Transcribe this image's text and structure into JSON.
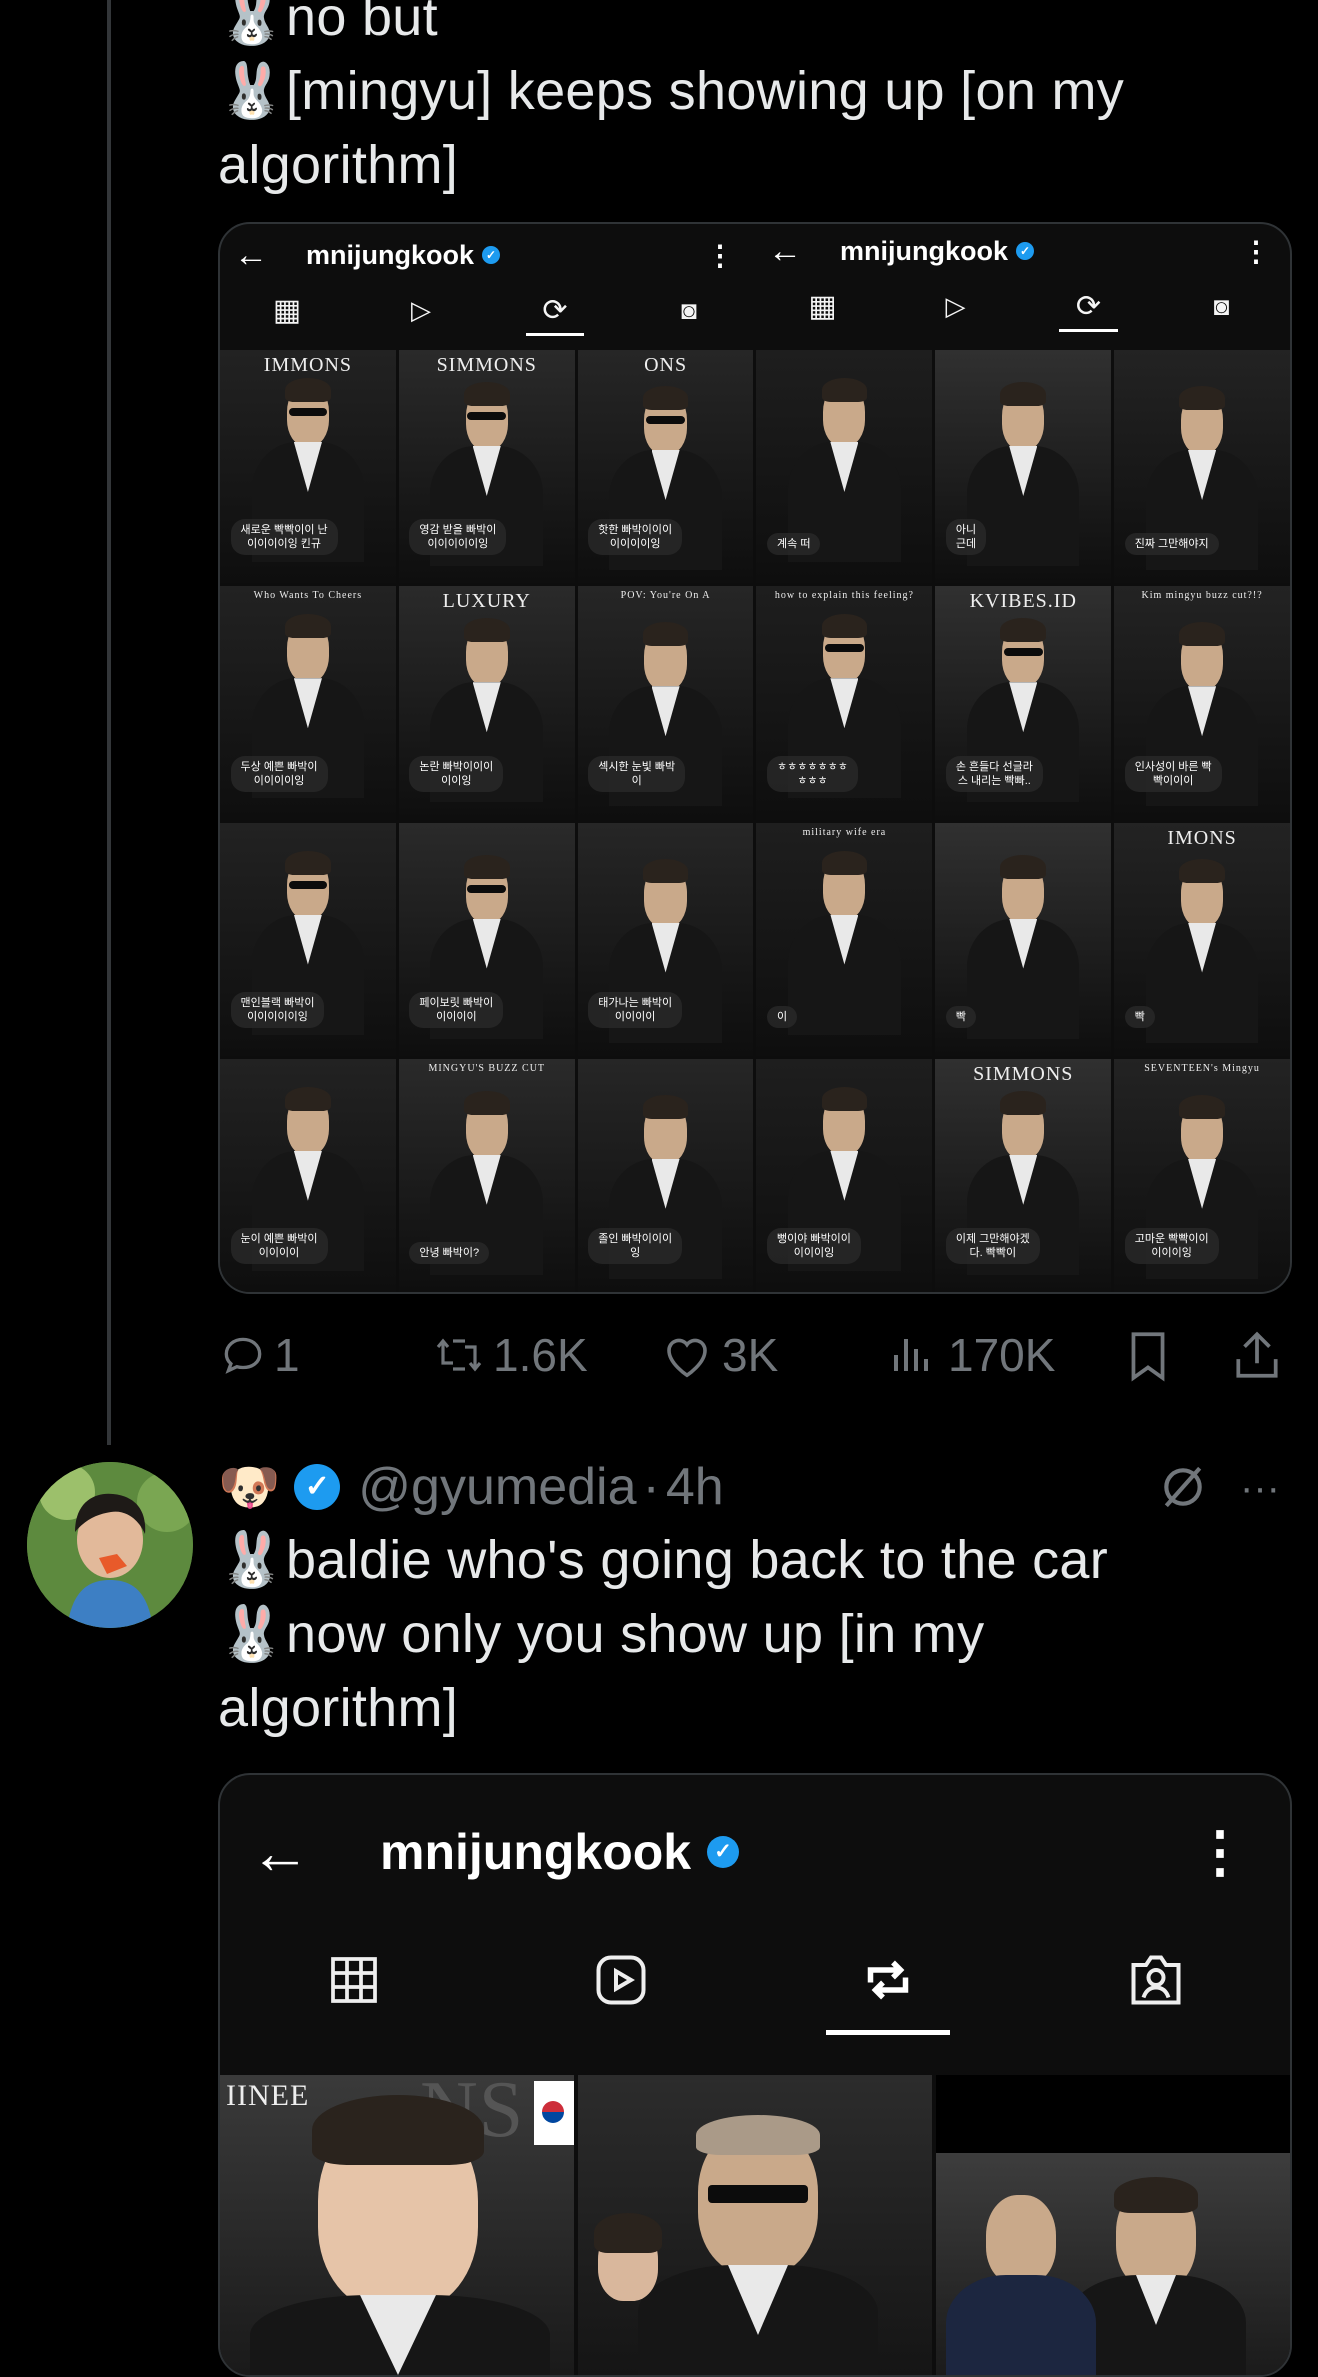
{
  "tweet1": {
    "line1": "no but",
    "line2": "[mingyu] keeps showing up [on my",
    "line3": "algorithm]",
    "emoji1": "🐰",
    "emoji2": "🐰"
  },
  "shot1": {
    "left": {
      "username": "mnijungkook"
    },
    "right": {
      "username": "mnijungkook"
    },
    "cells": [
      {
        "caption": "새로운 빡빡이이 난\n이이이이잉 킨규",
        "top": "IMMONS"
      },
      {
        "caption": "영감 받을 빠박이\n이이이이이잉",
        "top": "SIMMONS"
      },
      {
        "caption": "핫한 빠박이이이\n이이이이잉",
        "top": "ONS"
      },
      {
        "caption": "계속 떠",
        "top": ""
      },
      {
        "caption": "아니\n근데",
        "top": ""
      },
      {
        "caption": "진짜 그만해야지",
        "top": ""
      },
      {
        "caption": "두상 예쁜 빠박이\n이이이이잉",
        "top": "Who Wants To Cheers"
      },
      {
        "caption": "논란 빠박이이이\n이이잉",
        "top": "LUXURY"
      },
      {
        "caption": "섹시한 눈빛 빠박\n이",
        "top": "POV: You're On A"
      },
      {
        "caption": "ㅎㅎㅎㅎㅎㅎㅎ\nㅎㅎㅎ",
        "top": "how to explain this feeling?"
      },
      {
        "caption": "손 흔들다 선글라\n스 내리는 빡빠..",
        "top": "KVIBES.ID"
      },
      {
        "caption": "인사성이 바른 빡\n빡이이이",
        "top": "Kim mingyu buzz cut?!?"
      },
      {
        "caption": "맨인블랙 빠박이\n이이이이이잉",
        "top": ""
      },
      {
        "caption": "페이보릿 빠박이\n이이이이",
        "top": ""
      },
      {
        "caption": "태가나는 빠박이\n이이이이",
        "top": ""
      },
      {
        "caption": "이",
        "top": "military wife era"
      },
      {
        "caption": "빡",
        "top": ""
      },
      {
        "caption": "빡",
        "top": "IMONS"
      },
      {
        "caption": "눈이 예쁜 빠박이\n이이이이",
        "top": ""
      },
      {
        "caption": "안녕 빠박이?",
        "top": "MINGYU'S BUZZ CUT"
      },
      {
        "caption": "졸인 빠박이이이\n잉",
        "top": ""
      },
      {
        "caption": "뻥이야 빠박이이\n이이이잉",
        "top": ""
      },
      {
        "caption": "이제 그만해야겠\n다. 빡빡이",
        "top": "SIMMONS"
      },
      {
        "caption": "고마운 빡빡이이\n이이이잉",
        "top": "SEVENTEEN's Mingyu"
      }
    ]
  },
  "actions": {
    "replies": "1",
    "reposts": "1.6K",
    "likes": "3K",
    "views": "170K"
  },
  "tweet2": {
    "emoji_badge": "🐶",
    "handle": "@gyumedia",
    "dot": "·",
    "time": "4h",
    "more": "···",
    "line1": "baldie who's going back to the car",
    "line2": "now only you show up [in my",
    "line3": "algorithm]",
    "emoji1": "🐰",
    "emoji2": "🐰"
  },
  "shot2": {
    "username": "mnijungkook",
    "tile1_text": "IINEE",
    "tile1_overlay": "NS"
  },
  "colors": {
    "background": "#000000",
    "text": "#e7e9ea",
    "muted": "#71767b",
    "verified": "#1d9bf0",
    "border": "#2f3336"
  }
}
